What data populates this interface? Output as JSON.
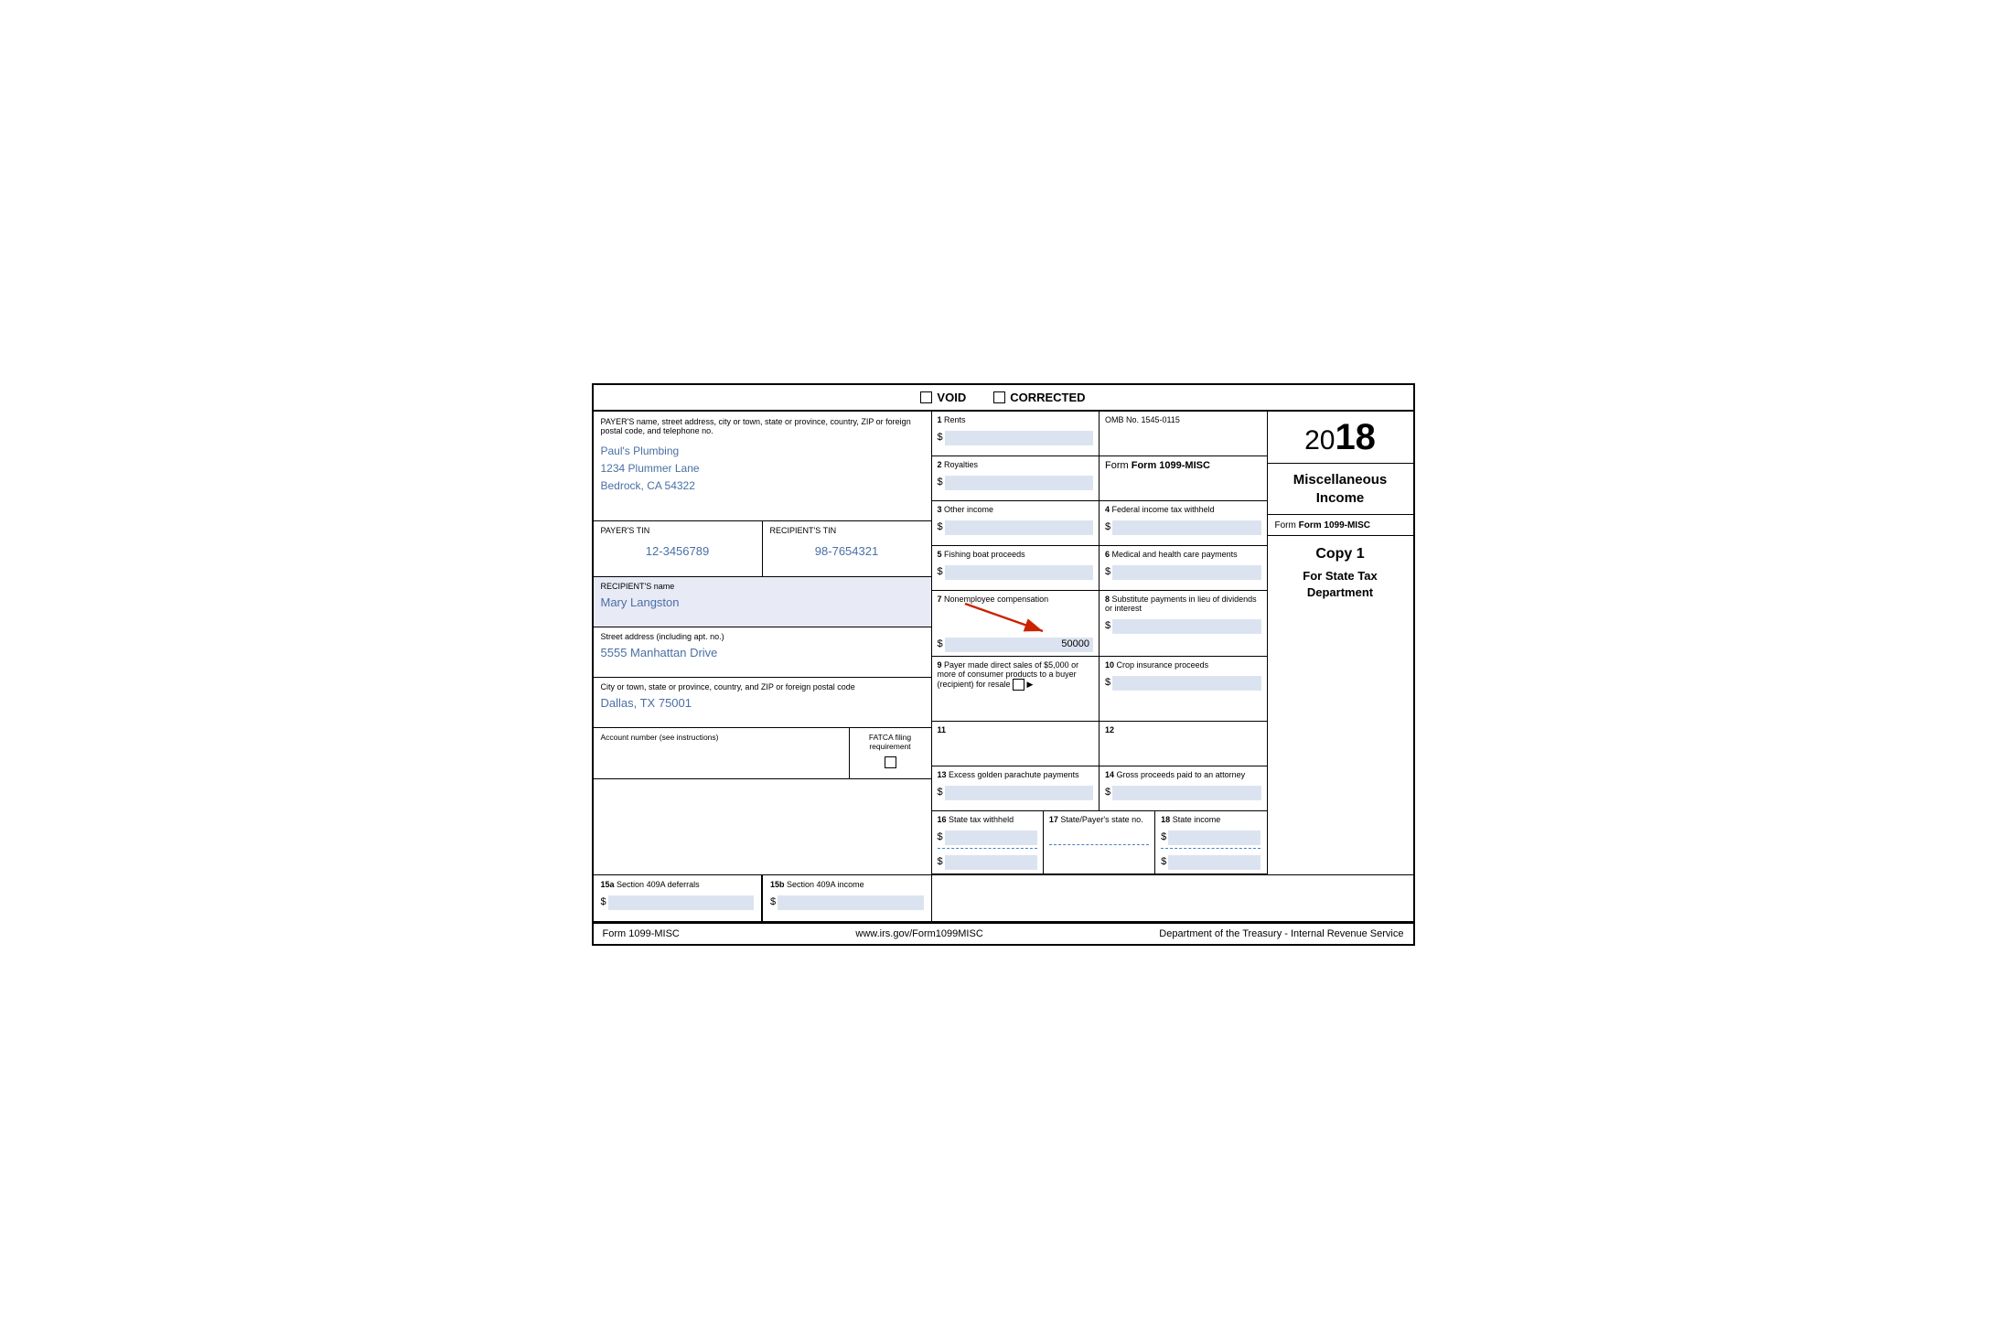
{
  "header": {
    "void_label": "VOID",
    "corrected_label": "CORRECTED"
  },
  "form": {
    "title": "Form 1099-MISC",
    "year": "2018",
    "year_prefix": "20",
    "year_suffix": "18",
    "omb": "OMB No. 1545-0115",
    "misc_income_title": "Miscellaneous Income",
    "copy_title": "Copy 1",
    "copy_subtitle": "For State Tax Department",
    "website": "www.irs.gov/Form1099MISC",
    "footer_dept": "Department of the Treasury - Internal Revenue Service"
  },
  "payer": {
    "label": "PAYER'S name, street address, city or town, state or province, country, ZIP or foreign postal code, and telephone no.",
    "name": "Paul's Plumbing",
    "address": "1234 Plummer Lane",
    "city_state_zip": "Bedrock, CA 54322",
    "tin_label": "PAYER'S TIN",
    "tin_value": "12-3456789"
  },
  "recipient": {
    "tin_label": "RECIPIENT'S TIN",
    "tin_value": "98-7654321",
    "name_label": "RECIPIENT'S name",
    "name_value": "Mary Langston",
    "street_label": "Street address (including apt. no.)",
    "street_value": "5555 Manhattan Drive",
    "city_label": "City or town, state or province, country, and ZIP or foreign postal code",
    "city_value": "Dallas, TX 75001"
  },
  "account": {
    "label": "Account number (see instructions)",
    "fatca_label": "FATCA filing requirement"
  },
  "boxes": {
    "box1_label": "1 Rents",
    "box1_num": "1",
    "box2_label": "2 Royalties",
    "box2_num": "2",
    "box3_label": "3 Other income",
    "box3_num": "3",
    "box4_label": "4 Federal income tax withheld",
    "box4_num": "4",
    "box5_label": "5 Fishing boat proceeds",
    "box5_num": "5",
    "box6_label": "6 Medical and health care payments",
    "box6_num": "6",
    "box7_label": "7 Nonemployee compensation",
    "box7_num": "7",
    "box7_value": "50000",
    "box8_label": "8 Substitute payments in lieu of dividends or interest",
    "box8_num": "8",
    "box9_label": "9 Payer made direct sales of $5,000 or more of consumer products to a buyer (recipient) for resale",
    "box9_num": "9",
    "box9_marker": "▶",
    "box10_label": "10 Crop insurance proceeds",
    "box10_num": "10",
    "box11_label": "11",
    "box11_num": "11",
    "box12_label": "12",
    "box12_num": "12",
    "box13_label": "13 Excess golden parachute payments",
    "box13_num": "13",
    "box14_label": "14 Gross proceeds paid to an attorney",
    "box14_num": "14",
    "box15a_label": "15a Section 409A deferrals",
    "box15a_num": "15a",
    "box15b_label": "15b Section 409A income",
    "box15b_num": "15b",
    "box16_label": "16 State tax withheld",
    "box16_num": "16",
    "box17_label": "17 State/Payer's state no.",
    "box17_num": "17",
    "box18_label": "18 State income",
    "box18_num": "18"
  }
}
